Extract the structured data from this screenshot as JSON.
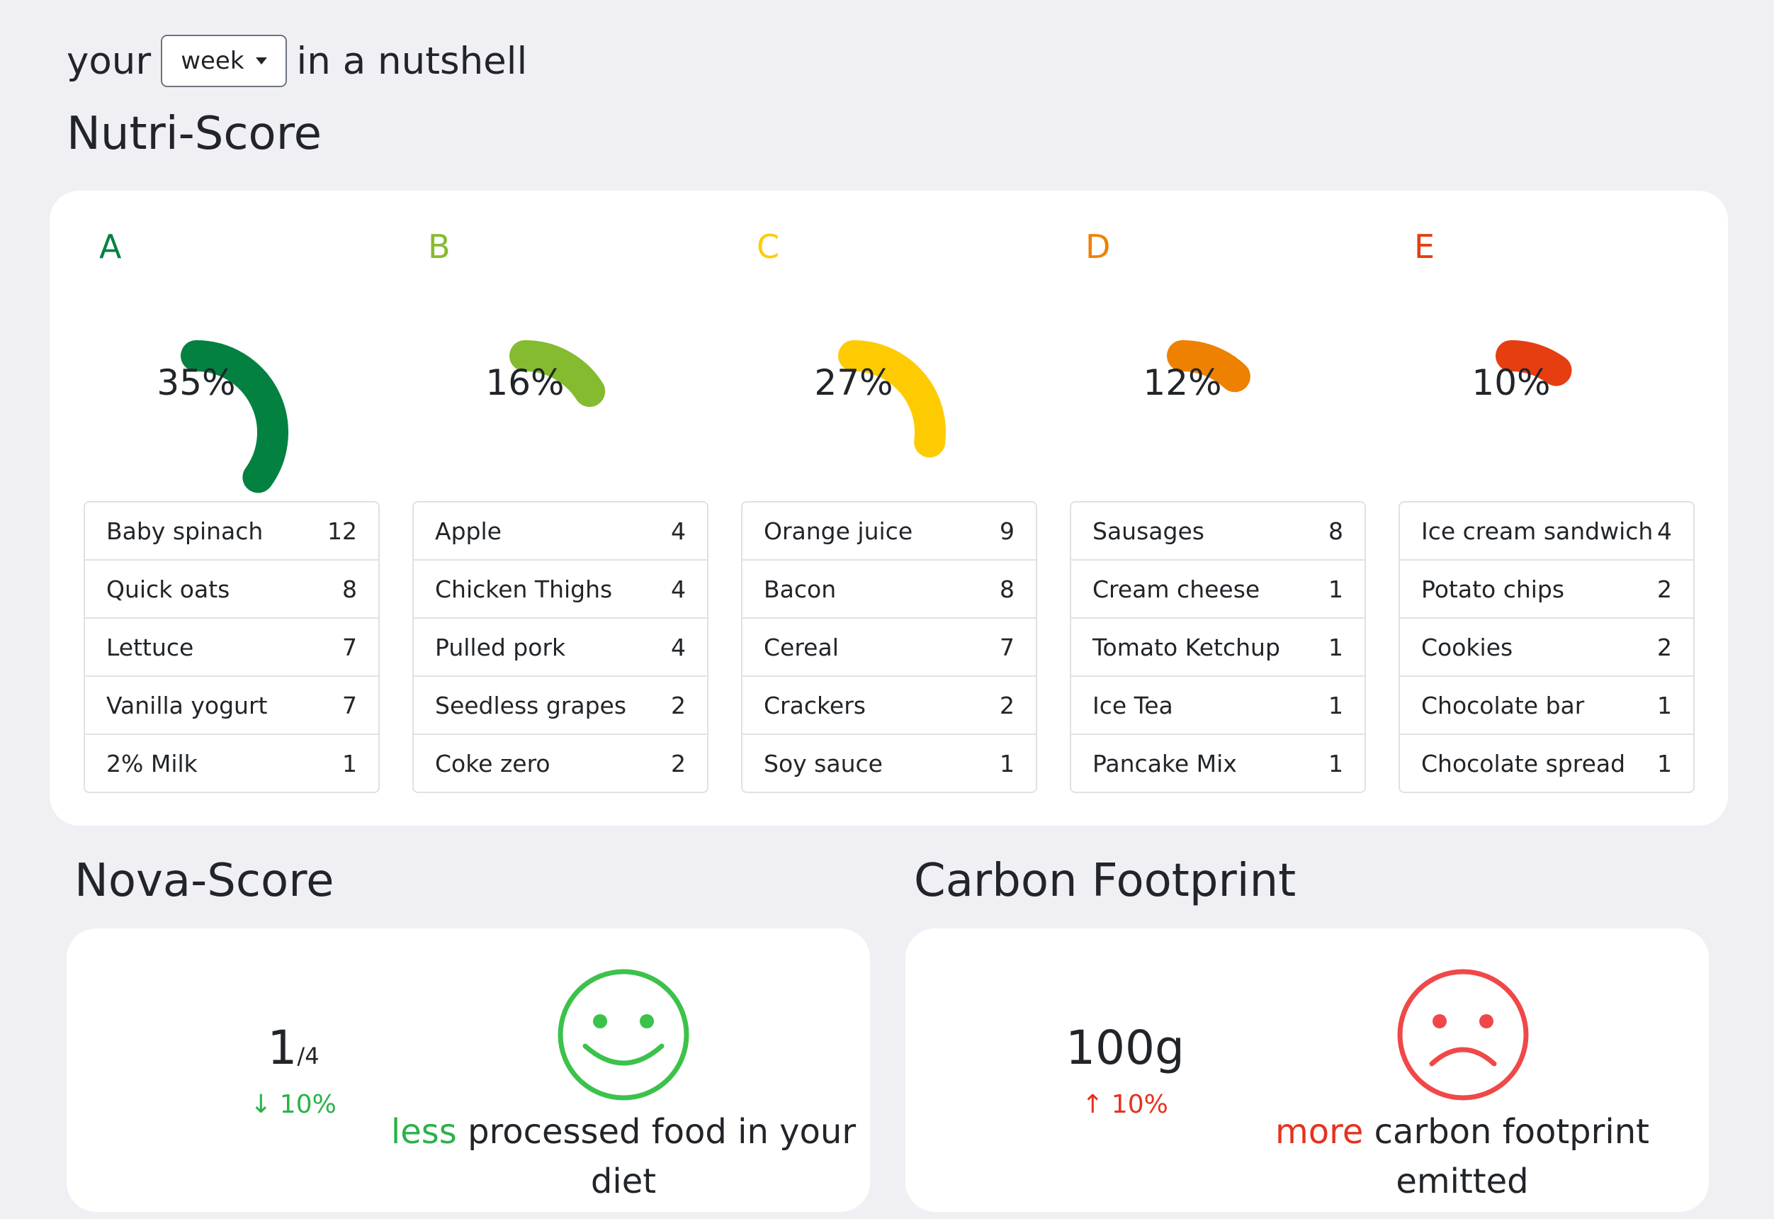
{
  "header": {
    "prefix": "your",
    "period": "week",
    "suffix": "in a nutshell"
  },
  "nutri_score": {
    "title": "Nutri-Score",
    "grades": [
      {
        "letter": "A",
        "percent": "35%",
        "fraction": 0.35,
        "color": "#038141",
        "items": [
          {
            "name": "Baby spinach",
            "count": "12"
          },
          {
            "name": "Quick oats",
            "count": "8"
          },
          {
            "name": "Lettuce",
            "count": "7"
          },
          {
            "name": "Vanilla yogurt",
            "count": "7"
          },
          {
            "name": "2% Milk",
            "count": "1"
          }
        ]
      },
      {
        "letter": "B",
        "percent": "16%",
        "fraction": 0.16,
        "color": "#85bb2f",
        "items": [
          {
            "name": "Apple",
            "count": "4"
          },
          {
            "name": "Chicken Thighs",
            "count": "4"
          },
          {
            "name": "Pulled pork",
            "count": "4"
          },
          {
            "name": "Seedless grapes",
            "count": "2"
          },
          {
            "name": "Coke zero",
            "count": "2"
          }
        ]
      },
      {
        "letter": "C",
        "percent": "27%",
        "fraction": 0.27,
        "color": "#fecb02",
        "items": [
          {
            "name": "Orange juice",
            "count": "9"
          },
          {
            "name": "Bacon",
            "count": "8"
          },
          {
            "name": "Cereal",
            "count": "7"
          },
          {
            "name": "Crackers",
            "count": "2"
          },
          {
            "name": "Soy sauce",
            "count": "1"
          }
        ]
      },
      {
        "letter": "D",
        "percent": "12%",
        "fraction": 0.12,
        "color": "#ee8100",
        "items": [
          {
            "name": "Sausages",
            "count": "8"
          },
          {
            "name": "Cream cheese",
            "count": "1"
          },
          {
            "name": "Tomato Ketchup",
            "count": "1"
          },
          {
            "name": "Ice Tea",
            "count": "1"
          },
          {
            "name": "Pancake Mix",
            "count": "1"
          }
        ]
      },
      {
        "letter": "E",
        "percent": "10%",
        "fraction": 0.1,
        "color": "#e63e11",
        "items": [
          {
            "name": "Ice cream sandwich",
            "count": "4"
          },
          {
            "name": "Potato chips",
            "count": "2"
          },
          {
            "name": "Cookies",
            "count": "2"
          },
          {
            "name": "Chocolate bar",
            "count": "1"
          },
          {
            "name": "Chocolate spread",
            "count": "1"
          }
        ]
      }
    ]
  },
  "nova": {
    "title": "Nova-Score",
    "value": "1",
    "denominator": "/4",
    "trend": "↓ 10%",
    "trend_color": "#2ab24a",
    "face": "smiley-face-icon",
    "face_color": "#3cc24a",
    "caption_highlight": "less",
    "caption_rest": "processed food in your diet"
  },
  "carbon": {
    "title": "Carbon Footprint",
    "value": "100g",
    "trend": "↑ 10%",
    "trend_color": "#e6321e",
    "face": "sad-face-icon",
    "face_color": "#f04848",
    "caption_highlight": "more",
    "caption_rest": "carbon footprint emitted"
  }
}
